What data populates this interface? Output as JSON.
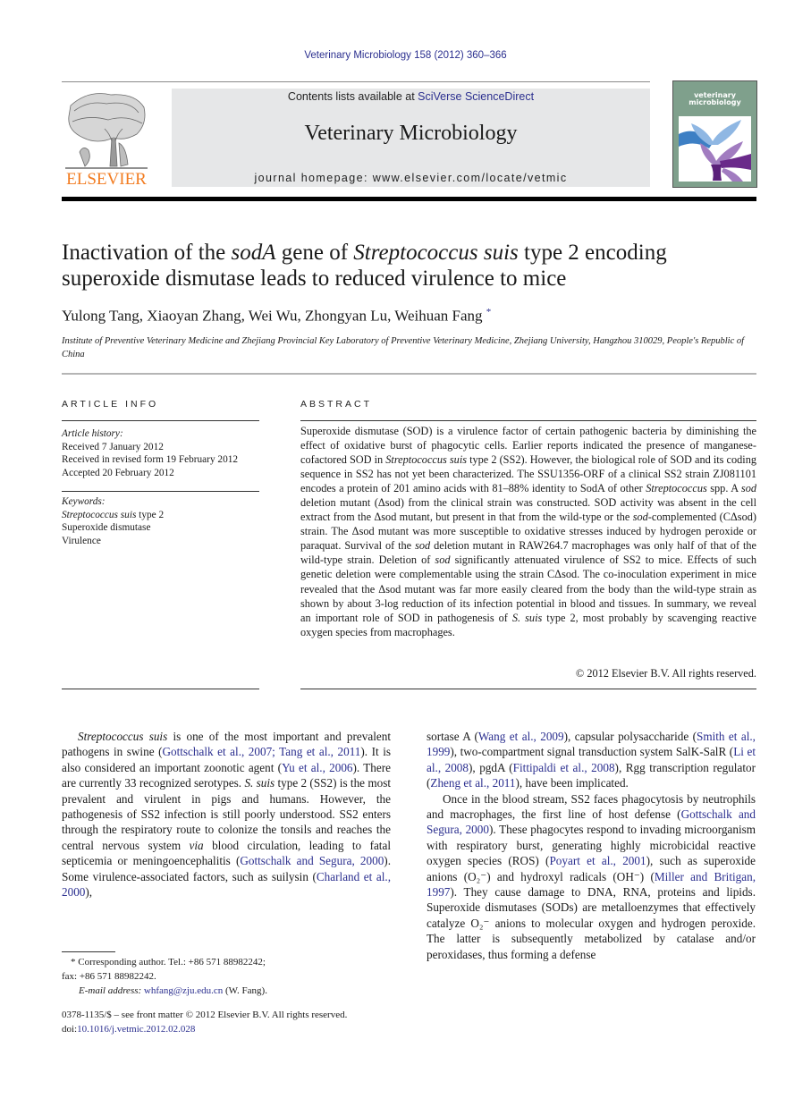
{
  "running_head": "Veterinary Microbiology 158 (2012) 360–366",
  "header": {
    "publisher_logo_label": "ELSEVIER",
    "contents_prefix": "Contents lists available at ",
    "contents_link": "SciVerse ScienceDirect",
    "journal_name": "Veterinary Microbiology",
    "homepage": "journal homepage: www.elsevier.com/locate/vetmic",
    "cover_title_line1": "veterinary",
    "cover_title_line2": "microbiology",
    "colors": {
      "publisher_orange": "#f27c21",
      "box_grey": "#e6e7e8",
      "cover_green": "#7fa08c",
      "link_blue": "#2b2f8f"
    }
  },
  "article": {
    "title_parts": {
      "p1": "Inactivation of the ",
      "i1": "sodA",
      "p2": " gene of ",
      "i2": "Streptococcus suis",
      "p3": " type 2 encoding superoxide dismutase leads to reduced virulence to mice"
    },
    "authors": "Yulong Tang, Xiaoyan Zhang, Wei Wu, Zhongyan Lu, Weihuan Fang",
    "corresponding_mark": "*",
    "affiliation": "Institute of Preventive Veterinary Medicine and Zhejiang Provincial Key Laboratory of Preventive Veterinary Medicine, Zhejiang University, Hangzhou 310029, People's Republic of China"
  },
  "article_info": {
    "heading": "ARTICLE INFO",
    "history_label": "Article history:",
    "received": "Received 7 January 2012",
    "revised": "Received in revised form 19 February 2012",
    "accepted": "Accepted 20 February 2012",
    "keywords_label": "Keywords:",
    "keywords": {
      "k1_italic": "Streptococcus suis",
      "k1_rest": " type 2",
      "k2": "Superoxide dismutase",
      "k3": "Virulence"
    }
  },
  "abstract": {
    "heading": "ABSTRACT",
    "s1": "Superoxide dismutase (SOD) is a virulence factor of certain pathogenic bacteria by diminishing the effect of oxidative burst of phagocytic cells. Earlier reports indicated the presence of manganese-cofactored SOD in ",
    "s1_i": "Streptococcus suis",
    "s2": " type 2 (SS2). However, the biological role of SOD and its coding sequence in SS2 has not yet been characterized. The SSU1356-ORF of a clinical SS2 strain ZJ081101 encodes a protein of 201 amino acids with 81–88% identity to SodA of other ",
    "s2_i": "Streptococcus",
    "s3": " spp. A ",
    "s3_i": "sod",
    "s4": " deletion mutant (Δsod) from the clinical strain was constructed. SOD activity was absent in the cell extract from the Δsod mutant, but present in that from the wild-type or the ",
    "s4_i": "sod",
    "s5": "-complemented (CΔsod) strain. The Δsod mutant was more susceptible to oxidative stresses induced by hydrogen peroxide or paraquat. Survival of the ",
    "s5_i": "sod",
    "s6": " deletion mutant in RAW264.7 macrophages was only half of that of the wild-type strain. Deletion of ",
    "s6_i": "sod",
    "s7": " significantly attenuated virulence of SS2 to mice. Effects of such genetic deletion were complementable using the strain CΔsod. The co-inoculation experiment in mice revealed that the Δsod mutant was far more easily cleared from the body than the wild-type strain as shown by about 3-log reduction of its infection potential in blood and tissues. In summary, we reveal an important role of SOD in pathogenesis of ",
    "s7_i": "S. suis",
    "s8": " type 2, most probably by scavenging reactive oxygen species from macrophages.",
    "copyright": "© 2012 Elsevier B.V. All rights reserved."
  },
  "body": {
    "left": {
      "a_i": "Streptococcus suis",
      "a1": " is one of the most important and prevalent pathogens in swine (",
      "ref1": "Gottschalk et al., 2007; Tang et al., 2011",
      "a2": "). It is also considered an important zoonotic agent (",
      "ref2": "Yu et al., 2006",
      "a3": "). There are currently 33 recognized serotypes. ",
      "a3_i": "S. suis",
      "a4": " type 2 (SS2) is the most prevalent and virulent in pigs and humans. However, the pathogenesis of SS2 infection is still poorly understood. SS2 enters through the respiratory route to colonize the tonsils and reaches the central nervous system ",
      "a4_i": "via",
      "a5": " blood circulation, leading to fatal septicemia or meningoencephalitis (",
      "ref3": "Gottschalk and Segura, 2000",
      "a6": "). Some virulence-associated factors, such as suilysin (",
      "ref4": "Charland et al., 2000",
      "a7": "),"
    },
    "right": {
      "b1": "sortase A (",
      "ref5": "Wang et al., 2009",
      "b2": "), capsular polysaccharide (",
      "ref6": "Smith et al., 1999",
      "b3": "), two-compartment signal transduction system SalK-SalR (",
      "ref7": "Li et al., 2008",
      "b4": "), pgdA (",
      "ref8": "Fittipaldi et al., 2008",
      "b5": "), Rgg transcription regulator (",
      "ref9": "Zheng et al., 2011",
      "b6": "), have been implicated.",
      "c1": "Once in the blood stream, SS2 faces phagocytosis by neutrophils and macrophages, the first line of host defense (",
      "ref10": "Gottschalk and Segura, 2000",
      "c2": "). These phagocytes respond to invading microorganism with respiratory burst, generating highly microbicidal reactive oxygen species (ROS) (",
      "ref11": "Poyart et al., 2001",
      "c3": "), such as superoxide anions (O₂⁻) and hydroxyl radicals (OH⁻) (",
      "ref12": "Miller and Britigan, 1997",
      "c4": "). They cause damage to DNA, RNA, proteins and lipids. Superoxide dismutases (SODs) are metalloenzymes that effectively catalyze O₂⁻ anions to molecular oxygen and hydrogen peroxide. The latter is subsequently metabolized by catalase and/or peroxidases, thus forming a defense"
    }
  },
  "footnote": {
    "line1": "* Corresponding author. Tel.: +86 571 88982242;",
    "line2": "fax: +86 571 88982242.",
    "email_label": "E-mail address: ",
    "email": "whfang@zju.edu.cn",
    "email_suffix": " (W. Fang).",
    "frontmatter": "0378-1135/$ – see front matter © 2012 Elsevier B.V. All rights reserved.",
    "doi_prefix": "doi:",
    "doi": "10.1016/j.vetmic.2012.02.028"
  }
}
